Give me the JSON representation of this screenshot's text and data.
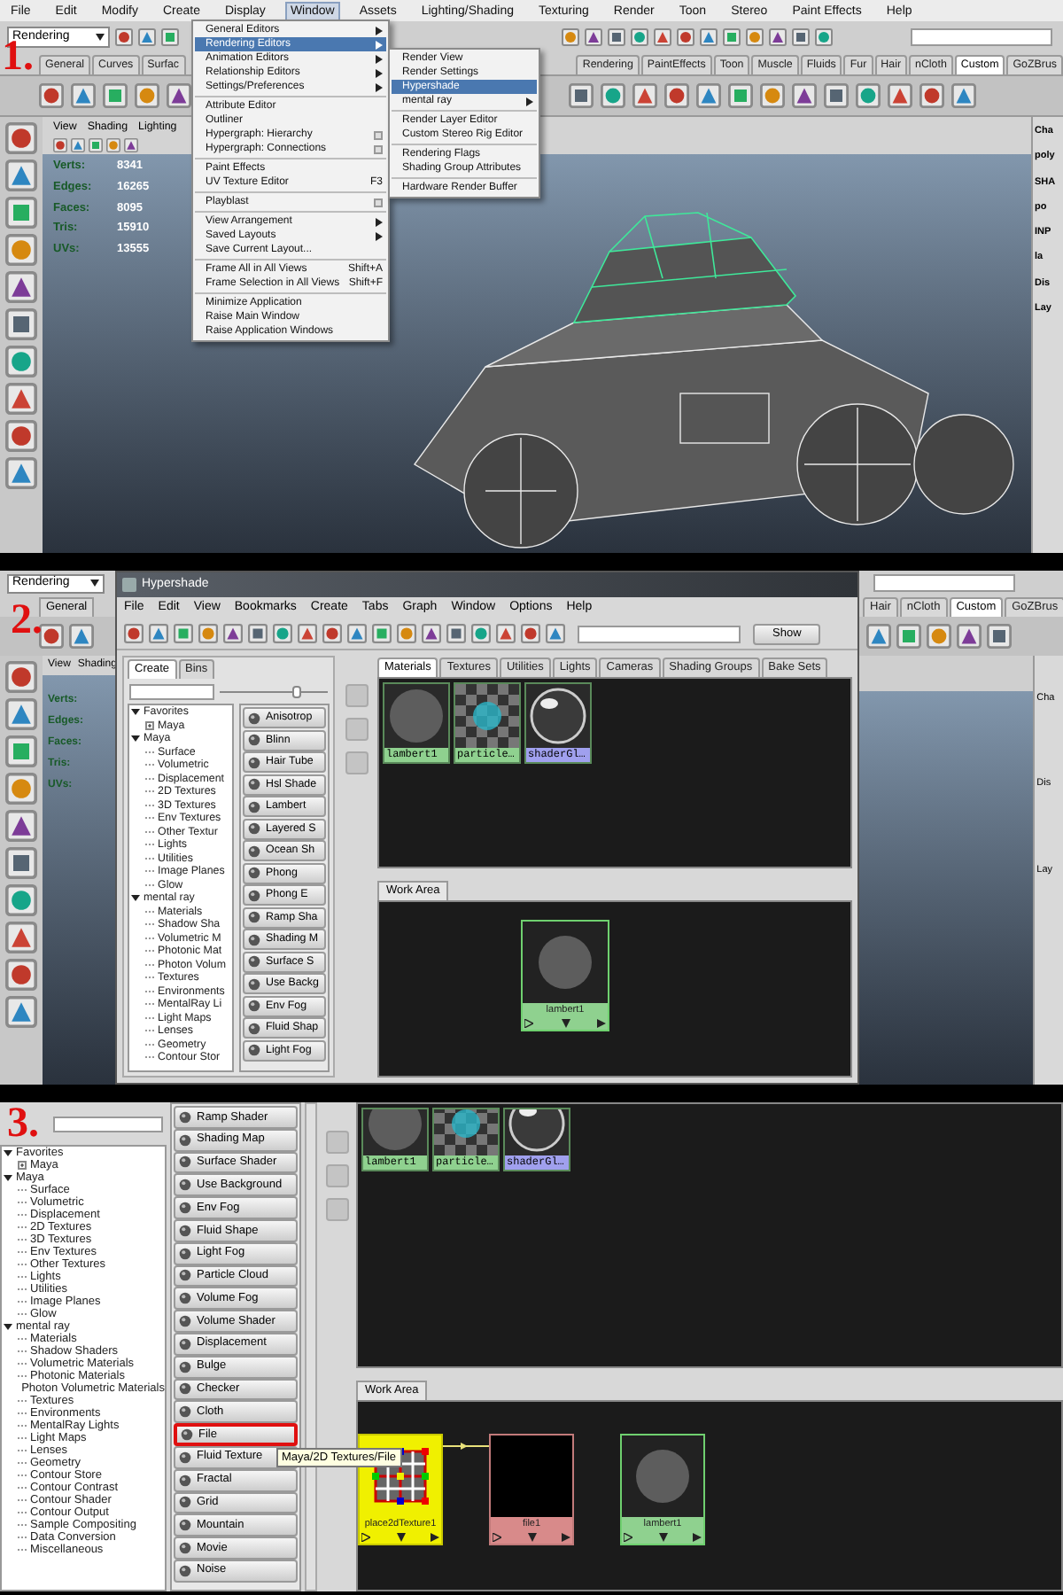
{
  "panel_1": {
    "step": "1.",
    "menubar": [
      {
        "label": "File",
        "selected": false
      },
      {
        "label": "Edit",
        "selected": false
      },
      {
        "label": "Modify",
        "selected": false
      },
      {
        "label": "Create",
        "selected": false
      },
      {
        "label": "Display",
        "selected": false
      },
      {
        "label": "Window",
        "selected": true
      },
      {
        "label": "Assets",
        "selected": false
      },
      {
        "label": "Lighting/Shading",
        "selected": false
      },
      {
        "label": "Texturing",
        "selected": false
      },
      {
        "label": "Render",
        "selected": false
      },
      {
        "label": "Toon",
        "selected": false
      },
      {
        "label": "Stereo",
        "selected": false
      },
      {
        "label": "Paint Effects",
        "selected": false
      },
      {
        "label": "Help",
        "selected": false
      }
    ],
    "mode_select": "Rendering",
    "shelf_tabs_left": [
      {
        "label": "General",
        "selected": false
      },
      {
        "label": "Curves",
        "selected": false
      },
      {
        "label": "Surfac",
        "selected": false
      }
    ],
    "shelf_tabs_right": [
      {
        "label": "Rendering",
        "selected": false
      },
      {
        "label": "PaintEffects",
        "selected": false
      },
      {
        "label": "Toon",
        "selected": false
      },
      {
        "label": "Muscle",
        "selected": false
      },
      {
        "label": "Fluids",
        "selected": false
      },
      {
        "label": "Fur",
        "selected": false
      },
      {
        "label": "Hair",
        "selected": false
      },
      {
        "label": "nCloth",
        "selected": false
      },
      {
        "label": "Custom",
        "selected": true
      },
      {
        "label": "GoZBrus",
        "selected": false
      }
    ],
    "viewport_menu": [
      "View",
      "Shading",
      "Lighting"
    ],
    "stats": [
      {
        "label": "Verts:",
        "value": "8341"
      },
      {
        "label": "Edges:",
        "value": "16265"
      },
      {
        "label": "Faces:",
        "value": "8095"
      },
      {
        "label": "Tris:",
        "value": "15910"
      },
      {
        "label": "UVs:",
        "value": "13555"
      }
    ],
    "channel_box": [
      "Cha",
      "poly",
      "SHA",
      "po",
      "INP",
      "la",
      "Dis",
      "Lay"
    ],
    "window_menu": [
      {
        "kind": "item",
        "label": "General Editors",
        "submenu": true,
        "selected": false
      },
      {
        "kind": "item",
        "label": "Rendering Editors",
        "submenu": true,
        "selected": true
      },
      {
        "kind": "item",
        "label": "Animation Editors",
        "submenu": true,
        "selected": false
      },
      {
        "kind": "item",
        "label": "Relationship Editors",
        "submenu": true,
        "selected": false
      },
      {
        "kind": "item",
        "label": "Settings/Preferences",
        "submenu": true,
        "selected": false
      },
      {
        "kind": "separator"
      },
      {
        "kind": "item",
        "label": "Attribute Editor",
        "selected": false
      },
      {
        "kind": "item",
        "label": "Outliner",
        "selected": false
      },
      {
        "kind": "item",
        "label": "Hypergraph: Hierarchy",
        "option_box": true,
        "selected": false
      },
      {
        "kind": "item",
        "label": "Hypergraph: Connections",
        "option_box": true,
        "selected": false
      },
      {
        "kind": "separator"
      },
      {
        "kind": "item",
        "label": "Paint Effects",
        "selected": false
      },
      {
        "kind": "item",
        "label": "UV Texture Editor",
        "shortcut": "F3",
        "selected": false
      },
      {
        "kind": "separator"
      },
      {
        "kind": "item",
        "label": "Playblast",
        "option_box": true,
        "selected": false
      },
      {
        "kind": "separator"
      },
      {
        "kind": "item",
        "label": "View Arrangement",
        "submenu": true,
        "selected": false
      },
      {
        "kind": "item",
        "label": "Saved Layouts",
        "submenu": true,
        "selected": false
      },
      {
        "kind": "item",
        "label": "Save Current Layout...",
        "selected": false
      },
      {
        "kind": "separator"
      },
      {
        "kind": "item",
        "label": "Frame All in All Views",
        "shortcut": "Shift+A",
        "selected": false
      },
      {
        "kind": "item",
        "label": "Frame Selection in All Views",
        "shortcut": "Shift+F",
        "selected": false
      },
      {
        "kind": "separator"
      },
      {
        "kind": "item",
        "label": "Minimize Application",
        "selected": false
      },
      {
        "kind": "item",
        "label": "Raise Main Window",
        "selected": false
      },
      {
        "kind": "item",
        "label": "Raise Application Windows",
        "selected": false
      }
    ],
    "rendering_submenu": [
      {
        "kind": "item",
        "label": "Render View",
        "selected": false
      },
      {
        "kind": "item",
        "label": "Render Settings",
        "selected": false
      },
      {
        "kind": "item",
        "label": "Hypershade",
        "selected": true
      },
      {
        "kind": "item",
        "label": "mental ray",
        "submenu": true,
        "selected": false
      },
      {
        "kind": "separator"
      },
      {
        "kind": "item",
        "label": "Render Layer Editor",
        "selected": false
      },
      {
        "kind": "item",
        "label": "Custom Stereo Rig Editor",
        "selected": false
      },
      {
        "kind": "separator"
      },
      {
        "kind": "item",
        "label": "Rendering Flags",
        "selected": false
      },
      {
        "kind": "item",
        "label": "Shading Group Attributes",
        "selected": false
      },
      {
        "kind": "separator"
      },
      {
        "kind": "item",
        "label": "Hardware Render Buffer",
        "selected": false
      }
    ]
  },
  "panel_2": {
    "step": "2.",
    "left_strip": {
      "mode_select": "Rendering",
      "shelf_tab": "General",
      "viewport_menu": [
        "View",
        "Shading"
      ],
      "stat_labels": [
        "Verts:",
        "Edges:",
        "Faces:",
        "Tris:",
        "UVs:"
      ]
    },
    "right_strip": {
      "shelf_tabs": [
        {
          "label": "Hair",
          "selected": false
        },
        {
          "label": "nCloth",
          "selected": false
        },
        {
          "label": "Custom",
          "selected": true
        },
        {
          "label": "GoZBrus",
          "selected": false
        }
      ],
      "channel_box": [
        "Cha",
        "Dis",
        "Lay"
      ]
    },
    "hypershade": {
      "title": "Hypershade",
      "menu": [
        "File",
        "Edit",
        "View",
        "Bookmarks",
        "Create",
        "Tabs",
        "Graph",
        "Window",
        "Options",
        "Help"
      ],
      "show_button": "Show",
      "zoom_slider": {
        "level": 0.72
      },
      "create_tabs": [
        {
          "label": "Create",
          "selected": true
        },
        {
          "label": "Bins",
          "selected": false
        }
      ],
      "tree": [
        {
          "label": "Favorites",
          "expanded": true,
          "children": [
            {
              "label": "Maya",
              "expanded": false
            }
          ]
        },
        {
          "label": "Maya",
          "expanded": true,
          "children": [
            {
              "label": "Surface"
            },
            {
              "label": "Volumetric"
            },
            {
              "label": "Displacement"
            },
            {
              "label": "2D Textures"
            },
            {
              "label": "3D Textures"
            },
            {
              "label": "Env Textures"
            },
            {
              "label": "Other Textur"
            },
            {
              "label": "Lights"
            },
            {
              "label": "Utilities"
            },
            {
              "label": "Image Planes"
            },
            {
              "label": "Glow"
            }
          ]
        },
        {
          "label": "mental ray",
          "expanded": true,
          "children": [
            {
              "label": "Materials"
            },
            {
              "label": "Shadow Sha"
            },
            {
              "label": "Volumetric M"
            },
            {
              "label": "Photonic Mat"
            },
            {
              "label": "Photon Volum"
            },
            {
              "label": "Textures"
            },
            {
              "label": "Environments"
            },
            {
              "label": "MentalRay Li"
            },
            {
              "label": "Light Maps"
            },
            {
              "label": "Lenses"
            },
            {
              "label": "Geometry"
            },
            {
              "label": "Contour Stor"
            }
          ]
        }
      ],
      "node_buttons": [
        {
          "label": "Anisotrop",
          "highlighted": false
        },
        {
          "label": "Blinn",
          "highlighted": false
        },
        {
          "label": "Hair Tube",
          "highlighted": false
        },
        {
          "label": "Hsl Shade",
          "highlighted": false
        },
        {
          "label": "Lambert",
          "highlighted": false
        },
        {
          "label": "Layered S",
          "highlighted": false
        },
        {
          "label": "Ocean Sh",
          "highlighted": false
        },
        {
          "label": "Phong",
          "highlighted": false
        },
        {
          "label": "Phong E",
          "highlighted": false
        },
        {
          "label": "Ramp Sha",
          "highlighted": false
        },
        {
          "label": "Shading M",
          "highlighted": false
        },
        {
          "label": "Surface S",
          "highlighted": false
        },
        {
          "label": "Use Backg",
          "highlighted": false
        },
        {
          "label": "Env Fog",
          "highlighted": false
        },
        {
          "label": "Fluid Shap",
          "highlighted": false
        },
        {
          "label": "Light Fog",
          "highlighted": false
        }
      ],
      "tabs": [
        {
          "label": "Materials",
          "selected": true
        },
        {
          "label": "Textures",
          "selected": false
        },
        {
          "label": "Utilities",
          "selected": false
        },
        {
          "label": "Lights",
          "selected": false
        },
        {
          "label": "Cameras",
          "selected": false
        },
        {
          "label": "Shading Groups",
          "selected": false
        },
        {
          "label": "Bake Sets",
          "selected": false
        }
      ],
      "swatches": [
        {
          "label": "lambert1",
          "kind": "lambert"
        },
        {
          "label": "particle…",
          "kind": "checker"
        },
        {
          "label": "shaderGl…",
          "kind": "shiny"
        }
      ],
      "work_area_tab": "Work Area",
      "work_nodes": [
        {
          "label": "lambert1",
          "kind": "material"
        }
      ]
    }
  },
  "panel_3": {
    "step": "3.",
    "tree": [
      {
        "label": "Favorites",
        "expanded": true,
        "children": [
          {
            "label": "Maya",
            "expanded": false
          }
        ]
      },
      {
        "label": "Maya",
        "expanded": true,
        "children": [
          {
            "label": "Surface"
          },
          {
            "label": "Volumetric"
          },
          {
            "label": "Displacement"
          },
          {
            "label": "2D Textures"
          },
          {
            "label": "3D Textures"
          },
          {
            "label": "Env Textures"
          },
          {
            "label": "Other Textures"
          },
          {
            "label": "Lights"
          },
          {
            "label": "Utilities"
          },
          {
            "label": "Image Planes"
          },
          {
            "label": "Glow"
          }
        ]
      },
      {
        "label": "mental ray",
        "expanded": true,
        "children": [
          {
            "label": "Materials"
          },
          {
            "label": "Shadow Shaders"
          },
          {
            "label": "Volumetric Materials"
          },
          {
            "label": "Photonic Materials"
          },
          {
            "label": "Photon Volumetric Materials"
          },
          {
            "label": "Textures"
          },
          {
            "label": "Environments"
          },
          {
            "label": "MentalRay Lights"
          },
          {
            "label": "Light Maps"
          },
          {
            "label": "Lenses"
          },
          {
            "label": "Geometry"
          },
          {
            "label": "Contour Store"
          },
          {
            "label": "Contour Contrast"
          },
          {
            "label": "Contour Shader"
          },
          {
            "label": "Contour Output"
          },
          {
            "label": "Sample Compositing"
          },
          {
            "label": "Data Conversion"
          },
          {
            "label": "Miscellaneous"
          }
        ]
      }
    ],
    "node_buttons": [
      {
        "label": "Ramp Shader",
        "highlighted": false
      },
      {
        "label": "Shading Map",
        "highlighted": false
      },
      {
        "label": "Surface Shader",
        "highlighted": false
      },
      {
        "label": "Use Background",
        "highlighted": false
      },
      {
        "label": "Env Fog",
        "highlighted": false
      },
      {
        "label": "Fluid Shape",
        "highlighted": false
      },
      {
        "label": "Light Fog",
        "highlighted": false
      },
      {
        "label": "Particle Cloud",
        "highlighted": false
      },
      {
        "label": "Volume Fog",
        "highlighted": false
      },
      {
        "label": "Volume Shader",
        "highlighted": false
      },
      {
        "label": "Displacement",
        "highlighted": false
      },
      {
        "label": "Bulge",
        "highlighted": false
      },
      {
        "label": "Checker",
        "highlighted": false
      },
      {
        "label": "Cloth",
        "highlighted": false
      },
      {
        "label": "File",
        "highlighted": true
      },
      {
        "label": "Fluid Texture",
        "highlighted": false
      },
      {
        "label": "Fractal",
        "highlighted": false
      },
      {
        "label": "Grid",
        "highlighted": false
      },
      {
        "label": "Mountain",
        "highlighted": false
      },
      {
        "label": "Movie",
        "highlighted": false
      },
      {
        "label": "Noise",
        "highlighted": false
      }
    ],
    "tooltip": "Maya/2D Textures/File",
    "swatches": [
      {
        "label": "lambert1",
        "kind": "lambert"
      },
      {
        "label": "particle…",
        "kind": "checker"
      },
      {
        "label": "shaderGl…",
        "kind": "shiny"
      }
    ],
    "work_area_tab": "Work Area",
    "work_nodes": [
      {
        "label": "place2dTexture1",
        "kind": "place2d"
      },
      {
        "label": "file1",
        "kind": "texture"
      },
      {
        "label": "lambert1",
        "kind": "material"
      }
    ]
  }
}
